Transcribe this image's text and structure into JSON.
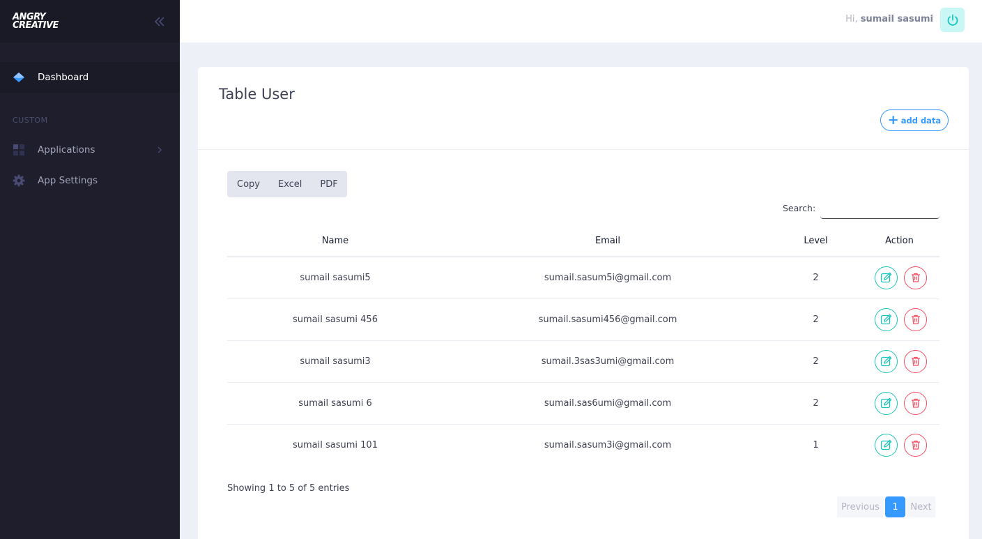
{
  "brand": {
    "logo_line1": "ANGRY",
    "logo_line2": "CREATIVE"
  },
  "sidebar": {
    "active_item": {
      "label": "Dashboard",
      "icon": "layers-icon"
    },
    "section_title": "CUSTOM",
    "items": [
      {
        "label": "Applications",
        "icon": "grid-icon",
        "has_chevron": true
      },
      {
        "label": "App Settings",
        "icon": "gear-icon",
        "has_chevron": false
      }
    ]
  },
  "header": {
    "greeting_prefix": "Hi,",
    "username": "sumail sasumi",
    "power_icon": "power-icon"
  },
  "card": {
    "title": "Table User",
    "add_button_label": "add data",
    "export_buttons": [
      "Copy",
      "Excel",
      "PDF"
    ],
    "search_label": "Search:",
    "search_value": "",
    "columns": [
      "Name",
      "Email",
      "Level",
      "Action"
    ],
    "rows": [
      {
        "name": "sumail sasumi5",
        "email": "sumail.sasum5i@gmail.com",
        "level": "2"
      },
      {
        "name": "sumail sasumi 456",
        "email": "sumail.sasumi456@gmail.com",
        "level": "2"
      },
      {
        "name": "sumail sasumi3",
        "email": "sumail.3sas3umi@gmail.com",
        "level": "2"
      },
      {
        "name": "sumail sasumi 6",
        "email": "sumail.sas6umi@gmail.com",
        "level": "2"
      },
      {
        "name": "sumail sasumi 101",
        "email": "sumail.sasum3i@gmail.com",
        "level": "1"
      }
    ],
    "info": "Showing 1 to 5 of 5 entries",
    "pagination": {
      "previous": "Previous",
      "current": "1",
      "next": "Next"
    }
  },
  "colors": {
    "sidebar_bg": "#1e1e2d",
    "primary": "#3699ff",
    "success": "#1bc5bd",
    "danger": "#f64e60",
    "page_bg": "#eef0f8"
  }
}
